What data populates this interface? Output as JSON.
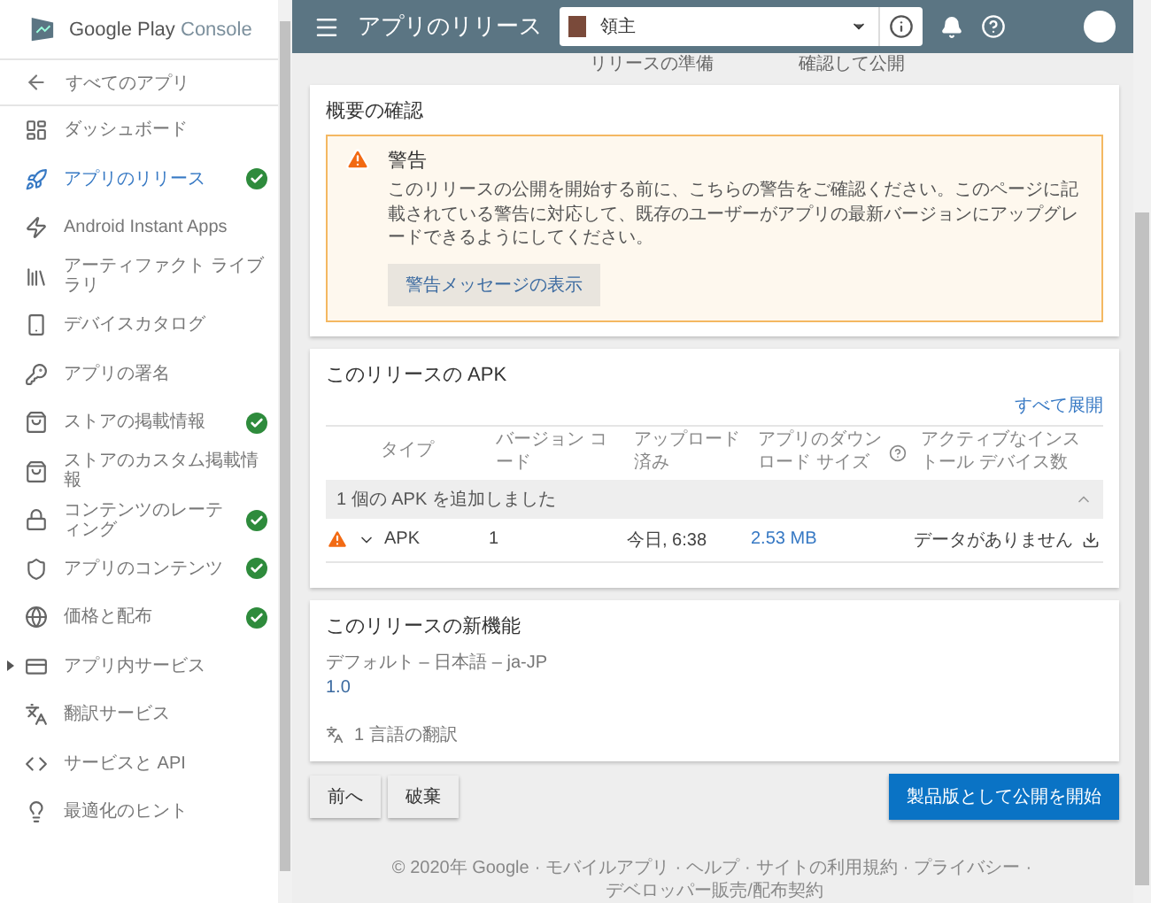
{
  "sidebar": {
    "logo": {
      "brand": "Google Play",
      "product": "Console"
    },
    "back": "すべてのアプリ",
    "items": [
      {
        "label": "ダッシュボード",
        "selected": false,
        "checked": false,
        "expandable": false
      },
      {
        "label": "アプリのリリース",
        "selected": true,
        "checked": true,
        "expandable": false
      },
      {
        "label": "Android Instant Apps",
        "selected": false,
        "checked": false,
        "expandable": false
      },
      {
        "label": "アーティファクト ライブラリ",
        "selected": false,
        "checked": false,
        "expandable": false
      },
      {
        "label": "デバイスカタログ",
        "selected": false,
        "checked": false,
        "expandable": false
      },
      {
        "label": "アプリの署名",
        "selected": false,
        "checked": false,
        "expandable": false
      },
      {
        "label": "ストアの掲載情報",
        "selected": false,
        "checked": true,
        "expandable": false
      },
      {
        "label": "ストアのカスタム掲載情報",
        "selected": false,
        "checked": false,
        "expandable": false
      },
      {
        "label": "コンテンツのレーティング",
        "selected": false,
        "checked": true,
        "expandable": false
      },
      {
        "label": "アプリのコンテンツ",
        "selected": false,
        "checked": true,
        "expandable": false
      },
      {
        "label": "価格と配布",
        "selected": false,
        "checked": true,
        "expandable": false
      },
      {
        "label": "アプリ内サービス",
        "selected": false,
        "checked": false,
        "expandable": true
      },
      {
        "label": "翻訳サービス",
        "selected": false,
        "checked": false,
        "expandable": false
      },
      {
        "label": "サービスと API",
        "selected": false,
        "checked": false,
        "expandable": false
      },
      {
        "label": "最適化のヒント",
        "selected": false,
        "checked": false,
        "expandable": false
      }
    ]
  },
  "topbar": {
    "title": "アプリのリリース",
    "app_select": {
      "value": "領主"
    }
  },
  "steps": [
    "リリースの準備",
    "確認して公開"
  ],
  "review": {
    "title": "概要の確認",
    "warning": {
      "title": "警告",
      "text": "このリリースの公開を開始する前に、こちらの警告をご確認ください。このページに記載されている警告に対応して、既存のユーザーがアプリの最新バージョンにアップグレードできるようにしてください。",
      "button": "警告メッセージの表示"
    }
  },
  "apk": {
    "title": "このリリースの APK",
    "expand_all": "すべて展開",
    "columns": [
      "タイプ",
      "バージョン コード",
      "アップロード済み",
      "アプリのダウンロード サイズ",
      "アクティブなインストール デバイス数"
    ],
    "group": {
      "label": "1 個の APK を追加しました",
      "expanded": true
    },
    "rows": [
      {
        "warning": true,
        "expanded": false,
        "type": "APK",
        "version_code": "1",
        "uploaded": "今日, 6:38",
        "size": "2.53 MB",
        "active_devices": "データがありません"
      }
    ]
  },
  "whats_new": {
    "title": "このリリースの新機能",
    "language": "デフォルト – 日本語 – ja-JP",
    "text": "1.0",
    "translations": "1 言語の翻訳"
  },
  "actions": {
    "left": [
      "前へ",
      "破棄"
    ],
    "primary": "製品版として公開を開始"
  },
  "footer": {
    "separator": "·",
    "items": [
      "© 2020年 Google",
      "モバイルアプリ",
      "ヘルプ",
      "サイトの利用規約",
      "プライバシー",
      "デベロッパー販売/配布契約"
    ]
  }
}
